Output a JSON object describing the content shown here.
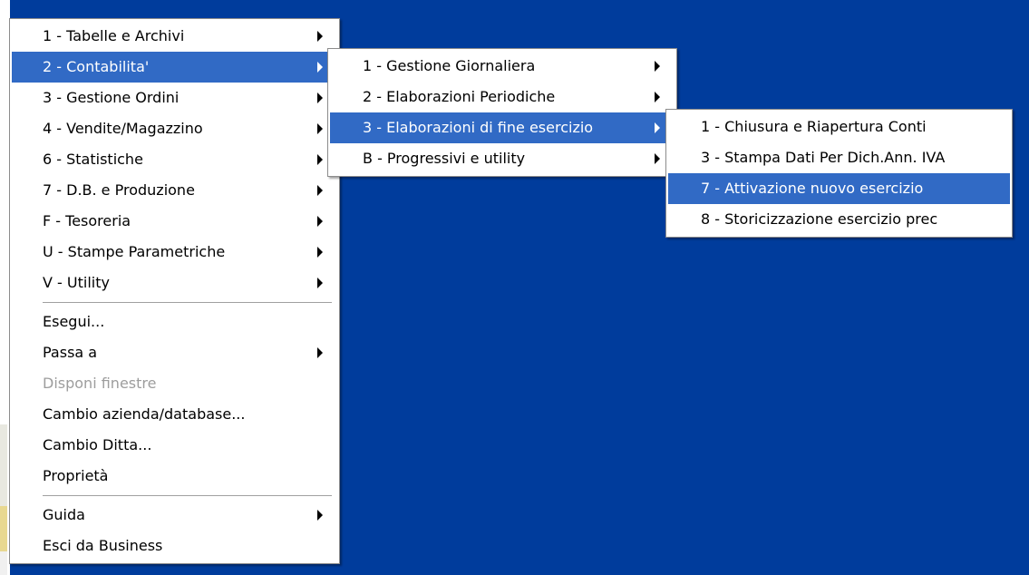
{
  "main_menu": {
    "items": [
      {
        "label": "1 - Tabelle e Archivi",
        "submenu": true
      },
      {
        "label": "2 - Contabilita'",
        "submenu": true,
        "selected": true
      },
      {
        "label": "3 - Gestione Ordini",
        "submenu": true
      },
      {
        "label": "4 - Vendite/Magazzino",
        "submenu": true
      },
      {
        "label": "6 - Statistiche",
        "submenu": true
      },
      {
        "label": "7 - D.B. e Produzione",
        "submenu": true
      },
      {
        "label": "F - Tesoreria",
        "submenu": true
      },
      {
        "label": "U - Stampe Parametriche",
        "submenu": true
      },
      {
        "label": "V - Utility",
        "submenu": true
      }
    ],
    "actions": [
      {
        "label": "Esegui...",
        "submenu": false
      },
      {
        "label": "Passa a",
        "submenu": true
      },
      {
        "label": "Disponi finestre",
        "submenu": false,
        "disabled": true
      },
      {
        "label": "Cambio azienda/database...",
        "submenu": false
      },
      {
        "label": "Cambio Ditta...",
        "submenu": false
      },
      {
        "label": "Proprietà",
        "submenu": false
      }
    ],
    "footer": [
      {
        "label": "Guida",
        "submenu": true
      },
      {
        "label": "Esci da Business",
        "submenu": false
      }
    ]
  },
  "contabilita_menu": {
    "items": [
      {
        "label": "1 - Gestione Giornaliera",
        "submenu": true
      },
      {
        "label": "2 - Elaborazioni Periodiche",
        "submenu": true
      },
      {
        "label": "3 - Elaborazioni di fine esercizio",
        "submenu": true,
        "selected": true
      },
      {
        "label": "B - Progressivi e utility",
        "submenu": true
      }
    ]
  },
  "fine_esercizio_menu": {
    "items": [
      {
        "label": "1 - Chiusura e Riapertura Conti"
      },
      {
        "label": "3 - Stampa Dati Per Dich.Ann. IVA"
      },
      {
        "label": "7 - Attivazione nuovo esercizio",
        "selected": true
      },
      {
        "label": "8 - Storicizzazione esercizio prec"
      }
    ]
  },
  "colors": {
    "desktop": "#003c9c",
    "highlight": "#316ac5",
    "disabled_text": "#9d9d9d"
  }
}
